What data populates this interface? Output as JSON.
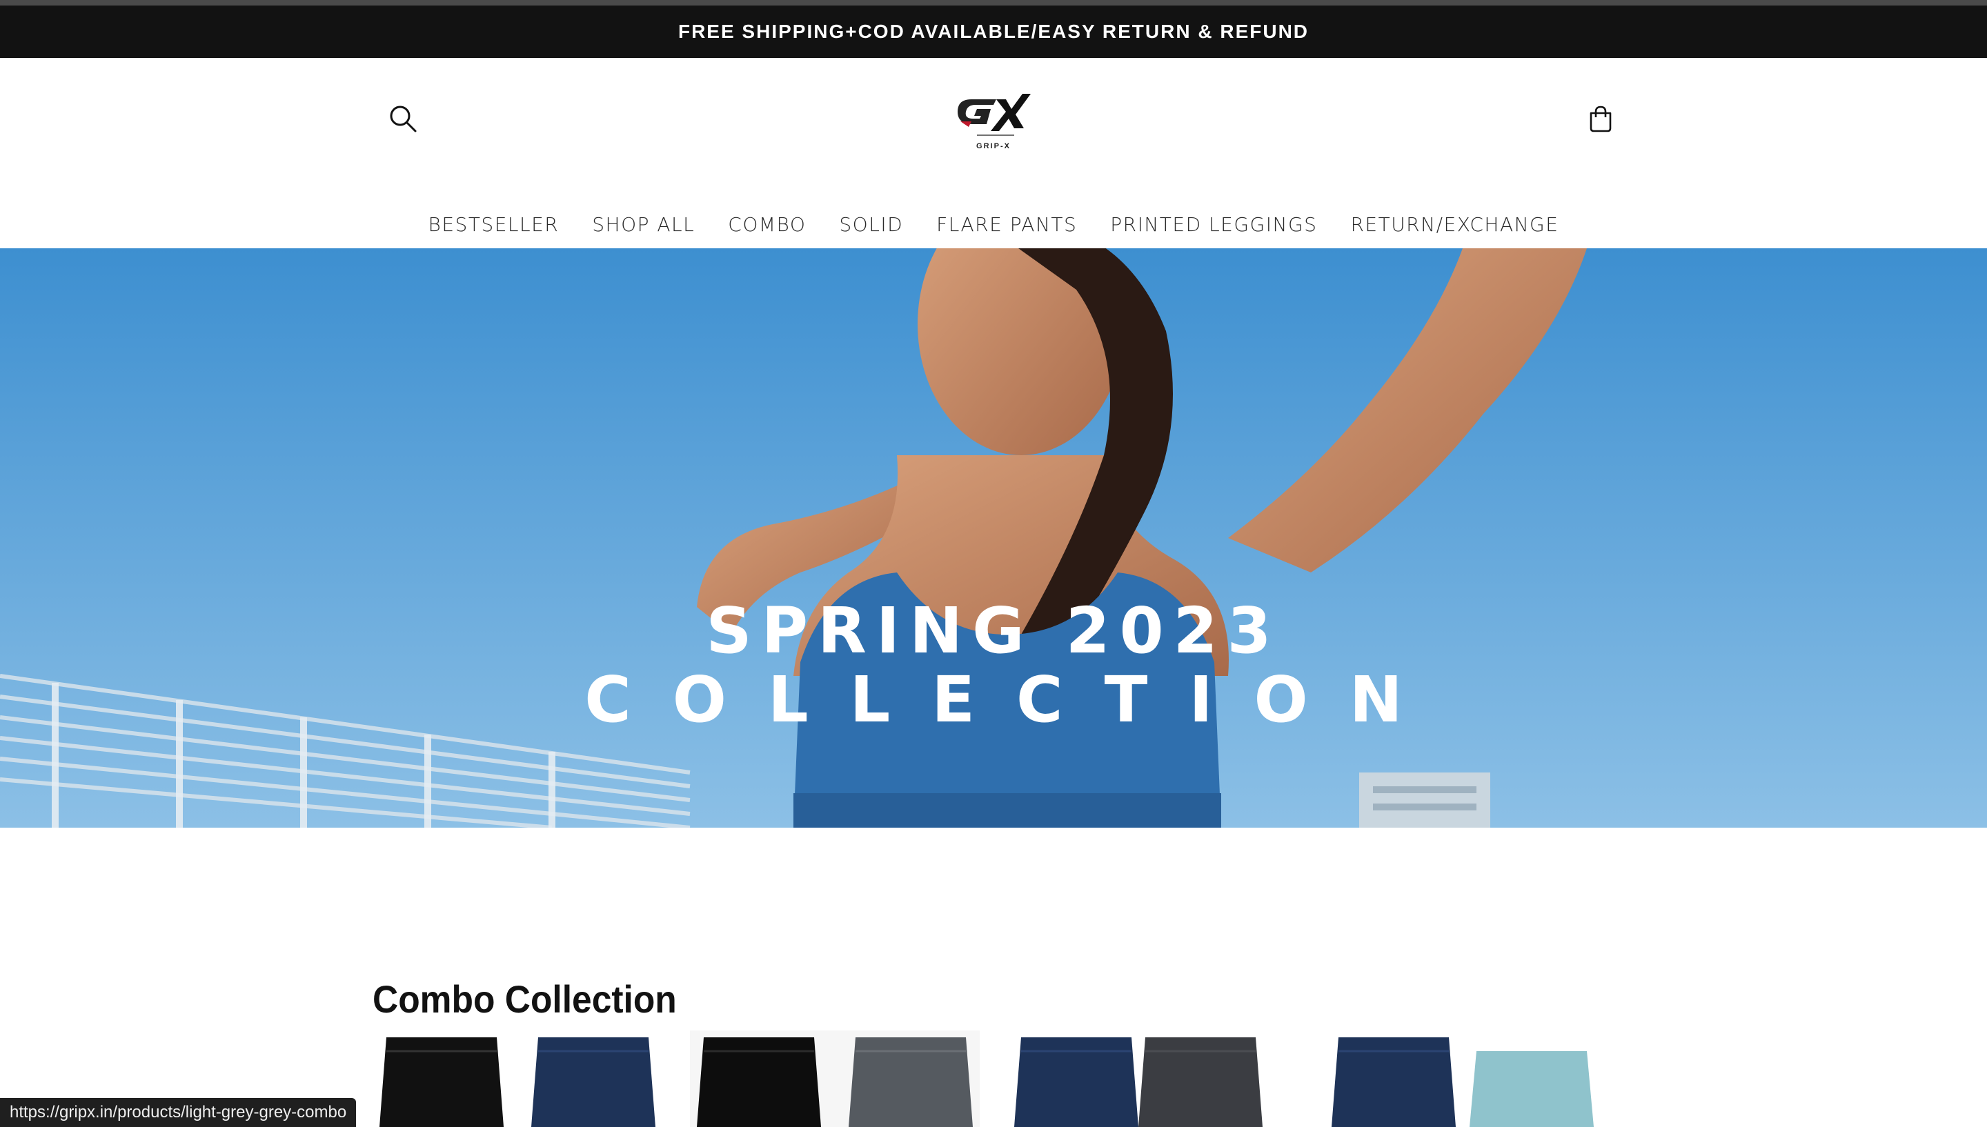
{
  "announcement": {
    "text": "FREE SHIPPING+COD AVAILABLE/EASY RETURN & REFUND"
  },
  "header": {
    "logo_text": "GX",
    "logo_sub": "GRIP-X",
    "search_icon": "search-icon",
    "cart_icon": "cart-icon"
  },
  "nav": {
    "items": [
      {
        "label": "BESTSELLER"
      },
      {
        "label": "SHOP ALL"
      },
      {
        "label": "COMBO"
      },
      {
        "label": "SOLID"
      },
      {
        "label": "FLARE PANTS"
      },
      {
        "label": "PRINTED LEGGINGS"
      },
      {
        "label": "RETURN/EXCHANGE"
      }
    ]
  },
  "hero": {
    "line1": "SPRING 2023",
    "line2": "COLLECTION"
  },
  "collection": {
    "title": "Combo Collection"
  },
  "status_bar": {
    "url": "https://gripx.in/products/light-grey-grey-combo"
  },
  "colors": {
    "announcement_bg": "#121212",
    "sky": "#4a98d4",
    "sports_bra": "#2f6fae"
  }
}
